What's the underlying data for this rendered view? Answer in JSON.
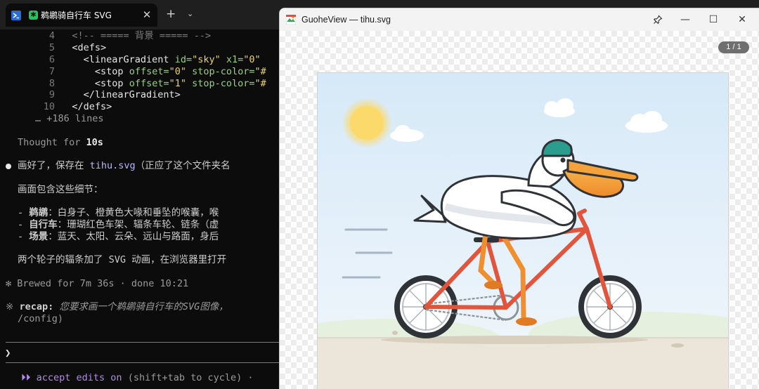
{
  "terminal": {
    "tab": {
      "title": "鹈鹕骑自行车 SVG",
      "status_glyph": "✱",
      "close": "✕"
    },
    "tab_new": "+",
    "tab_dropdown": "⌄",
    "code": [
      {
        "num": "4",
        "text": "<!-- ===== 背景 ===== -->"
      },
      {
        "num": "5",
        "text": "<defs>"
      },
      {
        "num": "6",
        "tag": "<linearGradient ",
        "attr1": "id=",
        "val1": "\"sky\"",
        "attr2": " x1=",
        "val2": "\"0\""
      },
      {
        "num": "7",
        "tag": "<stop ",
        "attr1": "offset=",
        "val1": "\"0\"",
        "attr2": " stop-color=",
        "val2": "\"#"
      },
      {
        "num": "8",
        "tag": "<stop ",
        "attr1": "offset=",
        "val1": "\"1\"",
        "attr2": " stop-color=",
        "val2": "\"#"
      },
      {
        "num": "9",
        "text": "</linearGradient>"
      },
      {
        "num": "10",
        "text": "</defs>"
      }
    ],
    "more_lines": "… +186 lines",
    "thought_prefix": "Thought for ",
    "thought_time": "10s",
    "message_start": "画好了，保存在 ",
    "message_file": "tihu.svg",
    "message_end": "（正应了这个文件夹名",
    "details_intro": "画面包含这些细节：",
    "details": [
      {
        "label": "鹈鹕",
        "text": "：白身子、橙黄色大喙和垂坠的喉囊，喉"
      },
      {
        "label": "自行车",
        "text": "：珊瑚红色车架、辐条车轮、链条（虚"
      },
      {
        "label": "场景",
        "text": "：蓝天、太阳、云朵、远山与路面，身后"
      }
    ],
    "animation_note": "两个轮子的辐条加了 SVG 动画，在浏览器里打开",
    "brewed_symbol": "✻",
    "brewed": "Brewed for 7m 36s · done 10:21",
    "recap_symbol": "※",
    "recap_label": "recap:",
    "recap_text": "您要求画一个鹈鹕骑自行车的SVG图像，",
    "recap_cont": "/config)",
    "prompt_caret": "❯",
    "mode_arrows": "⏵⏵",
    "mode_label": "accept edits on",
    "mode_hint": "(shift+tab to cycle) ·"
  },
  "viewer": {
    "title": "GuoheView — tihu.svg",
    "buttons": {
      "pin": "📌",
      "minimize": "—",
      "maximize": "☐",
      "close": "✕"
    },
    "page_indicator": "1 / 1",
    "colors": {
      "sky_top": "#d6e9f8",
      "sky_bottom": "#f2f7fb",
      "sun": "#fcd96b",
      "ground": "#ece6da",
      "frame": "#e2553c",
      "tire": "#2f3338",
      "beak": "#f5a23a",
      "helmet": "#2a9d8f"
    }
  }
}
